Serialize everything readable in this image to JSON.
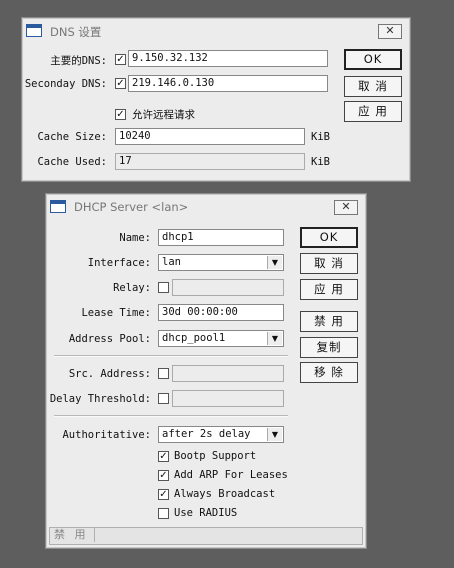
{
  "dns": {
    "title": "DNS 设置",
    "primary_label": "主要的DNS:",
    "primary_checked": true,
    "primary_value": "9.150.32.132",
    "secondary_label": "Seconday DNS:",
    "secondary_checked": true,
    "secondary_value": "219.146.0.130",
    "allow_remote_label": "允许远程请求",
    "allow_remote_checked": true,
    "cache_size_label": "Cache Size:",
    "cache_size_value": "10240",
    "cache_size_unit": "KiB",
    "cache_used_label": "Cache Used:",
    "cache_used_value": "17",
    "cache_used_unit": "KiB",
    "buttons": {
      "ok": "OK",
      "cancel": "取 消",
      "apply": "应 用"
    }
  },
  "dhcp": {
    "title": "DHCP Server <lan>",
    "name_label": "Name:",
    "name_value": "dhcp1",
    "interface_label": "Interface:",
    "interface_value": "lan",
    "relay_label": "Relay:",
    "relay_value": "",
    "lease_label": "Lease Time:",
    "lease_value": "30d 00:00:00",
    "pool_label": "Address Pool:",
    "pool_value": "dhcp_pool1",
    "src_label": "Src. Address:",
    "src_value": "",
    "delay_label": "Delay Threshold:",
    "delay_value": "",
    "auth_label": "Authoritative:",
    "auth_value": "after 2s delay",
    "bootp_label": "Bootp Support",
    "bootp_checked": true,
    "arp_label": "Add ARP For Leases",
    "arp_checked": true,
    "broadcast_label": "Always Broadcast",
    "broadcast_checked": true,
    "radius_label": "Use RADIUS",
    "radius_checked": false,
    "status_text": "禁 用",
    "buttons": {
      "ok": "OK",
      "cancel": "取 消",
      "apply": "应 用",
      "disable": "禁 用",
      "copy": "复制",
      "remove": "移 除"
    }
  },
  "icons": {
    "close": "close-icon",
    "window": "window-icon",
    "dropdown": "chevron-down-icon",
    "check": "checkmark"
  }
}
